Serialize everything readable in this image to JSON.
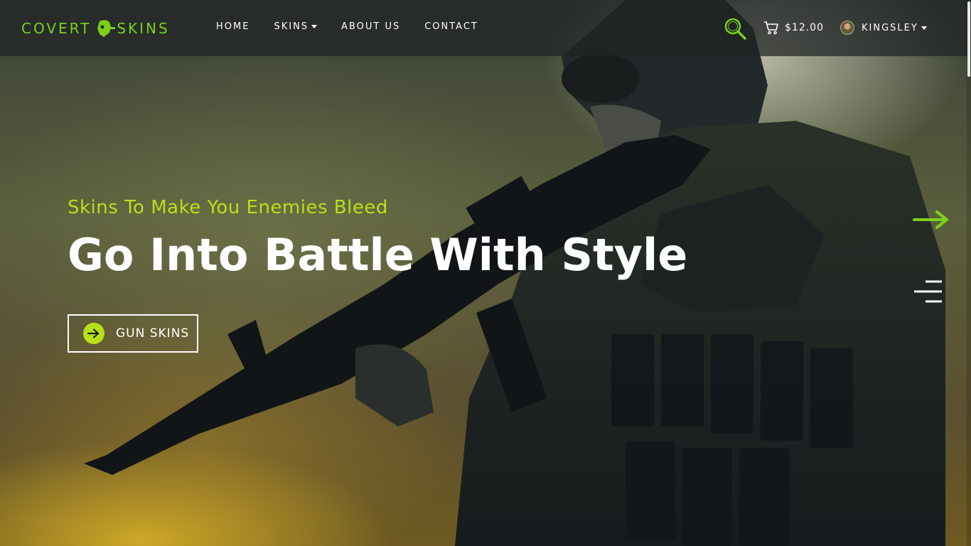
{
  "brand": {
    "logo_left": "COVERT",
    "logo_right": "SKINS"
  },
  "nav": {
    "items": [
      {
        "label": "HOME"
      },
      {
        "label": "SKINS",
        "has_dropdown": true
      },
      {
        "label": "ABOUT US"
      },
      {
        "label": "CONTACT"
      }
    ]
  },
  "header": {
    "search_icon": "search-icon",
    "cart": {
      "icon": "cart-icon",
      "amount": "$12.00"
    },
    "user": {
      "name": "KINGSLEY",
      "has_dropdown": true
    }
  },
  "hero": {
    "subheading": "Skins To Make You Enemies Bleed",
    "headline": "Go Into Battle With Style",
    "cta_label": "GUN SKINS",
    "cta_icon": "arrow-right-icon"
  },
  "controls": {
    "next_icon": "arrow-right-icon",
    "menu_icon": "menu-icon"
  },
  "colors": {
    "accent": "#b8e018",
    "logo_green": "#7bd11b",
    "nav_bg": "#1e2224",
    "text": "#ffffff"
  }
}
